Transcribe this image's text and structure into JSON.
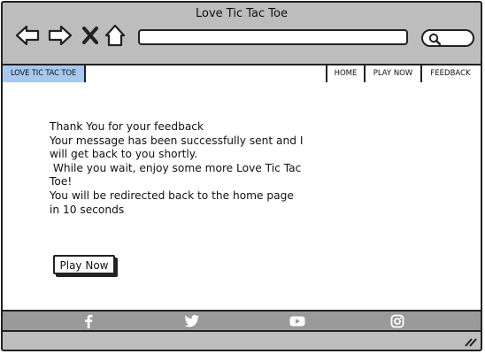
{
  "window": {
    "title": "Love Tic Tac Toe"
  },
  "browser": {
    "back_icon": "back-arrow-icon",
    "forward_icon": "forward-arrow-icon",
    "close_icon": "close-x-icon",
    "home_icon": "home-icon",
    "url_value": "",
    "search_icon": "search-icon"
  },
  "menubar": {
    "brand": "LOVE TIC TAC TOE",
    "items": [
      {
        "label": "HOME"
      },
      {
        "label": "PLAY NOW"
      },
      {
        "label": "FEEDBACK"
      }
    ]
  },
  "main": {
    "lines": [
      "Thank You for your feedback",
      "Your message has been successfully sent and I will get back to you shortly.",
      " While you wait, enjoy some more Love Tic Tac Toe!",
      "You will be redirected back to the home page in 10 seconds"
    ],
    "play_button": "Play Now"
  },
  "footer": {
    "icons": [
      "facebook-icon",
      "twitter-icon",
      "youtube-icon",
      "instagram-icon"
    ]
  },
  "colors": {
    "chrome": "#bdbdbd",
    "brand_highlight": "#a8c8f0",
    "footer": "#9a9a9a"
  }
}
